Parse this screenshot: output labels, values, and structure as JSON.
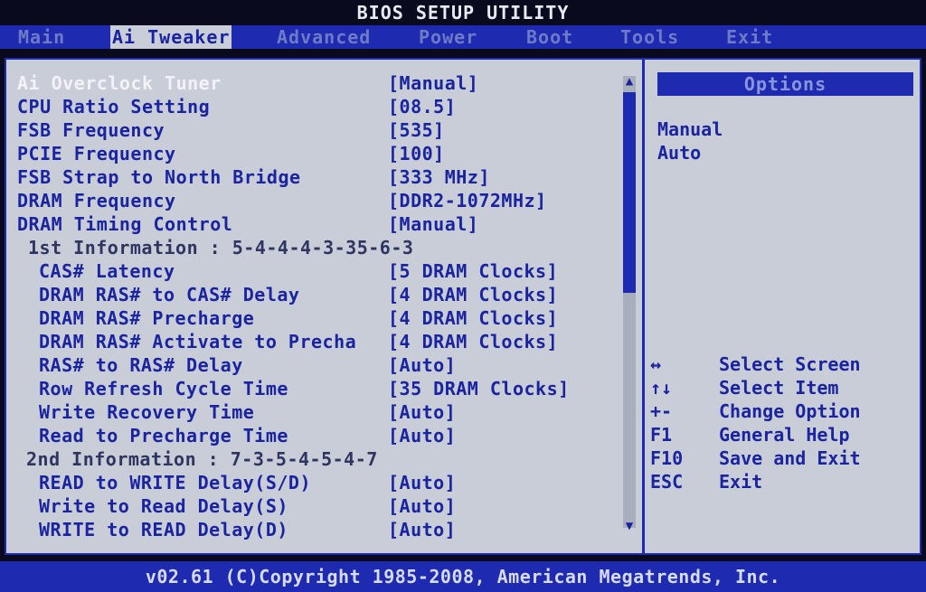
{
  "title": "BIOS SETUP UTILITY",
  "menu": [
    "Main",
    "Ai Tweaker",
    "Advanced",
    "Power",
    "Boot",
    "Tools",
    "Exit"
  ],
  "settings": [
    {
      "label": "Ai Overclock Tuner",
      "value": "[Manual]"
    },
    {
      "label": "CPU Ratio Setting",
      "value": "[08.5]"
    },
    {
      "label": "FSB Frequency",
      "value": "[535]"
    },
    {
      "label": "PCIE Frequency",
      "value": "[100]"
    },
    {
      "label": "FSB Strap to North Bridge",
      "value": "[333 MHz]"
    },
    {
      "label": "DRAM Frequency",
      "value": "[DDR2-1072MHz]"
    },
    {
      "label": "DRAM Timing Control",
      "value": "[Manual]"
    },
    {
      "label": "1st Information : 5-4-4-4-3-35-6-3",
      "value": ""
    },
    {
      "label": "CAS# Latency",
      "value": "[5 DRAM Clocks]"
    },
    {
      "label": "DRAM RAS# to CAS# Delay",
      "value": "[4 DRAM Clocks]"
    },
    {
      "label": "DRAM RAS# Precharge",
      "value": "[4 DRAM Clocks]"
    },
    {
      "label": "DRAM RAS# Activate to Precha",
      "value": "[4 DRAM Clocks]"
    },
    {
      "label": "RAS# to RAS# Delay",
      "value": "[Auto]"
    },
    {
      "label": "Row Refresh Cycle Time",
      "value": "[35 DRAM Clocks]"
    },
    {
      "label": "Write Recovery Time",
      "value": "[Auto]"
    },
    {
      "label": "Read to Precharge Time",
      "value": "[Auto]"
    },
    {
      "label": "2nd Information : 7-3-5-4-5-4-7",
      "value": ""
    },
    {
      "label": "READ to WRITE Delay(S/D)",
      "value": "[Auto]"
    },
    {
      "label": "Write to Read Delay(S)",
      "value": "[Auto]"
    },
    {
      "label": "WRITE to READ Delay(D)",
      "value": "[Auto]"
    }
  ],
  "options": {
    "header": "Options",
    "items": [
      "Manual",
      "Auto"
    ]
  },
  "keys": [
    {
      "key": "↔",
      "desc": "Select Screen"
    },
    {
      "key": "↑↓",
      "desc": "Select Item"
    },
    {
      "key": "+-",
      "desc": "Change Option"
    },
    {
      "key": "F1",
      "desc": "General Help"
    },
    {
      "key": "F10",
      "desc": "Save and Exit"
    },
    {
      "key": "ESC",
      "desc": "Exit"
    }
  ],
  "footer": "v02.61 (C)Copyright 1985-2008, American Megatrends, Inc."
}
